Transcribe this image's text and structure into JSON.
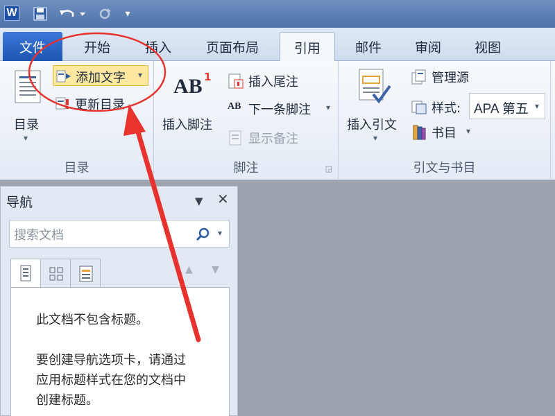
{
  "quick_access": {
    "word_letter": "W",
    "customize_label": "▾"
  },
  "tabs": [
    {
      "label": "文件"
    },
    {
      "label": "开始"
    },
    {
      "label": "插入"
    },
    {
      "label": "页面布局"
    },
    {
      "label": "引用"
    },
    {
      "label": "邮件"
    },
    {
      "label": "审阅"
    },
    {
      "label": "视图"
    }
  ],
  "ribbon": {
    "toc_group": {
      "toc_button": "目录",
      "add_text": "添加文字",
      "update_toc": "更新目录",
      "label": "目录"
    },
    "footnote_group": {
      "ab_icon_text": "AB",
      "ab_sup": "1",
      "insert_footnote": "插入脚注",
      "insert_endnote": "插入尾注",
      "next_footnote_icon_text": "AB",
      "next_footnote": "下一条脚注",
      "show_notes": "显示备注",
      "label": "脚注"
    },
    "citation_group": {
      "insert_citation": "插入引文",
      "manage_sources": "管理源",
      "style_label": "样式:",
      "style_value": "APA 第五",
      "bibliography": "书目",
      "label": "引文与书目"
    }
  },
  "nav_pane": {
    "title": "导航",
    "search_placeholder": "搜索文档",
    "message_line1": "此文档不包含标题。",
    "message_line2": "要创建导航选项卡，请通过",
    "message_line3": "应用标题样式在您的文档中",
    "message_line4": "创建标题。"
  },
  "colors": {
    "file_tab": "#1d56b3",
    "highlight": "#ffe9a0",
    "annotation": "#e8322e"
  }
}
